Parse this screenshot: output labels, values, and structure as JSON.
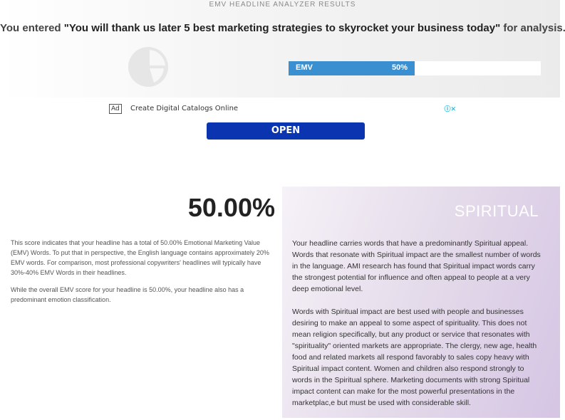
{
  "header": {
    "results_title": "EMV HEADLINE ANALYZER RESULTS",
    "entered_prefix": "You entered ",
    "headline": "\"You will thank us later 5 best marketing strategies to skyrocket your business today\"",
    "entered_suffix": " for analysis."
  },
  "emv_bar": {
    "label": "EMV",
    "percent_text": "50%",
    "fill_fraction": 0.5,
    "fill_color": "#3a8fd0"
  },
  "ad": {
    "badge": "Ad",
    "text": "Create Digital Catalogs Online",
    "close_icon": "adchoices-close-icon",
    "button_label": "OPEN",
    "button_color": "#0b35b0"
  },
  "score": {
    "value_text": "50.00%",
    "paragraphs": [
      "This score indicates that your headline has a total of 50.00% Emotional Marketing Value (EMV) Words. To put that in perspective, the English language contains approximately 20% EMV words. For comparison, most professional copywriters' headlines will typically have 30%-40% EMV Words in their headlines.",
      "While the overall EMV score for your headline is 50.00%, your headline also has a predominant emotion classification."
    ]
  },
  "emotion": {
    "title": "SPIRITUAL",
    "paragraphs": [
      "Your headline carries words that have a predominantly Spiritual appeal. Words that resonate with Spiritual impact are the smallest number of words in the language. AMI research has found that Spiritual impact words carry the strongest potential for influence and often appeal to people at a very deep emotional level.",
      "Words with Spiritual impact are best used with people and businesses desiring to make an appeal to some aspect of spirituality. This does not mean religion specifically, but any product or service that resonates with \"spirituality\" oriented markets are appropriate. The clergy, new age, health food and related markets all respond favorably to sales copy heavy with Spiritual impact content. Women and children also respond strongly to words in the Spiritual sphere. Marketing documents with strong Spiritual impact content can make for the most powerful presentations in the marketplac,e but must be used with considerable skill."
    ]
  }
}
